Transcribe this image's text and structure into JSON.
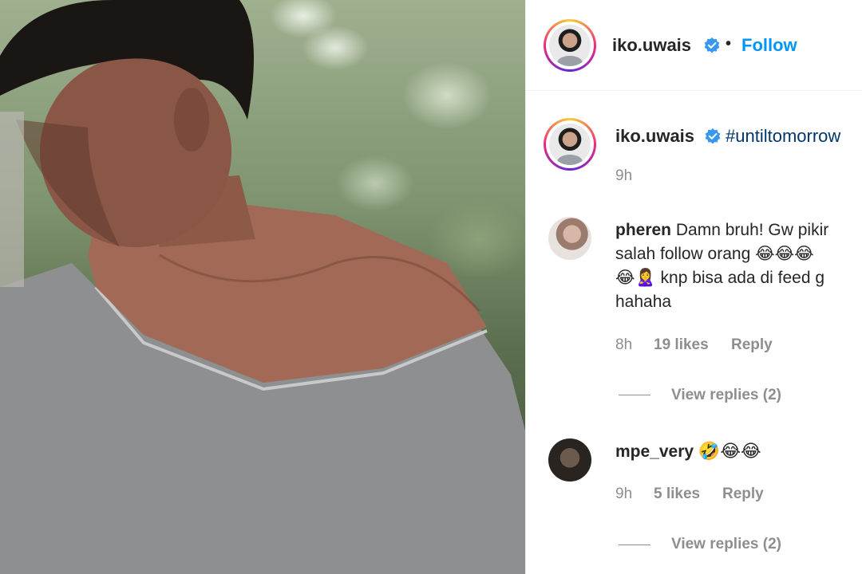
{
  "post": {
    "author": "iko.uwais",
    "follow_label": "Follow",
    "separator": "•",
    "caption_hashtag": "#untiltomorrow",
    "caption_time": "9h"
  },
  "comments": [
    {
      "username": "pheren",
      "line1": "Damn bruh! Gw pikir",
      "line2": "salah follow orang 😂😂😂",
      "line3": "😂🙎‍♀️ knp bisa ada di feed g",
      "line4": "hahaha",
      "time": "8h",
      "likes": "19 likes",
      "reply": "Reply",
      "view_replies": "View replies (2)"
    },
    {
      "username": "mpe_very",
      "text": "🤣😂😂",
      "time": "9h",
      "likes": "5 likes",
      "reply": "Reply",
      "view_replies": "View replies (2)"
    }
  ],
  "icons": {
    "verified": "verified-badge-icon",
    "avatar": "profile-avatar"
  },
  "colors": {
    "follow_blue": "#0095f6",
    "hashtag": "#00376b",
    "muted": "#8e8e8e",
    "verified": "#3897f0"
  }
}
